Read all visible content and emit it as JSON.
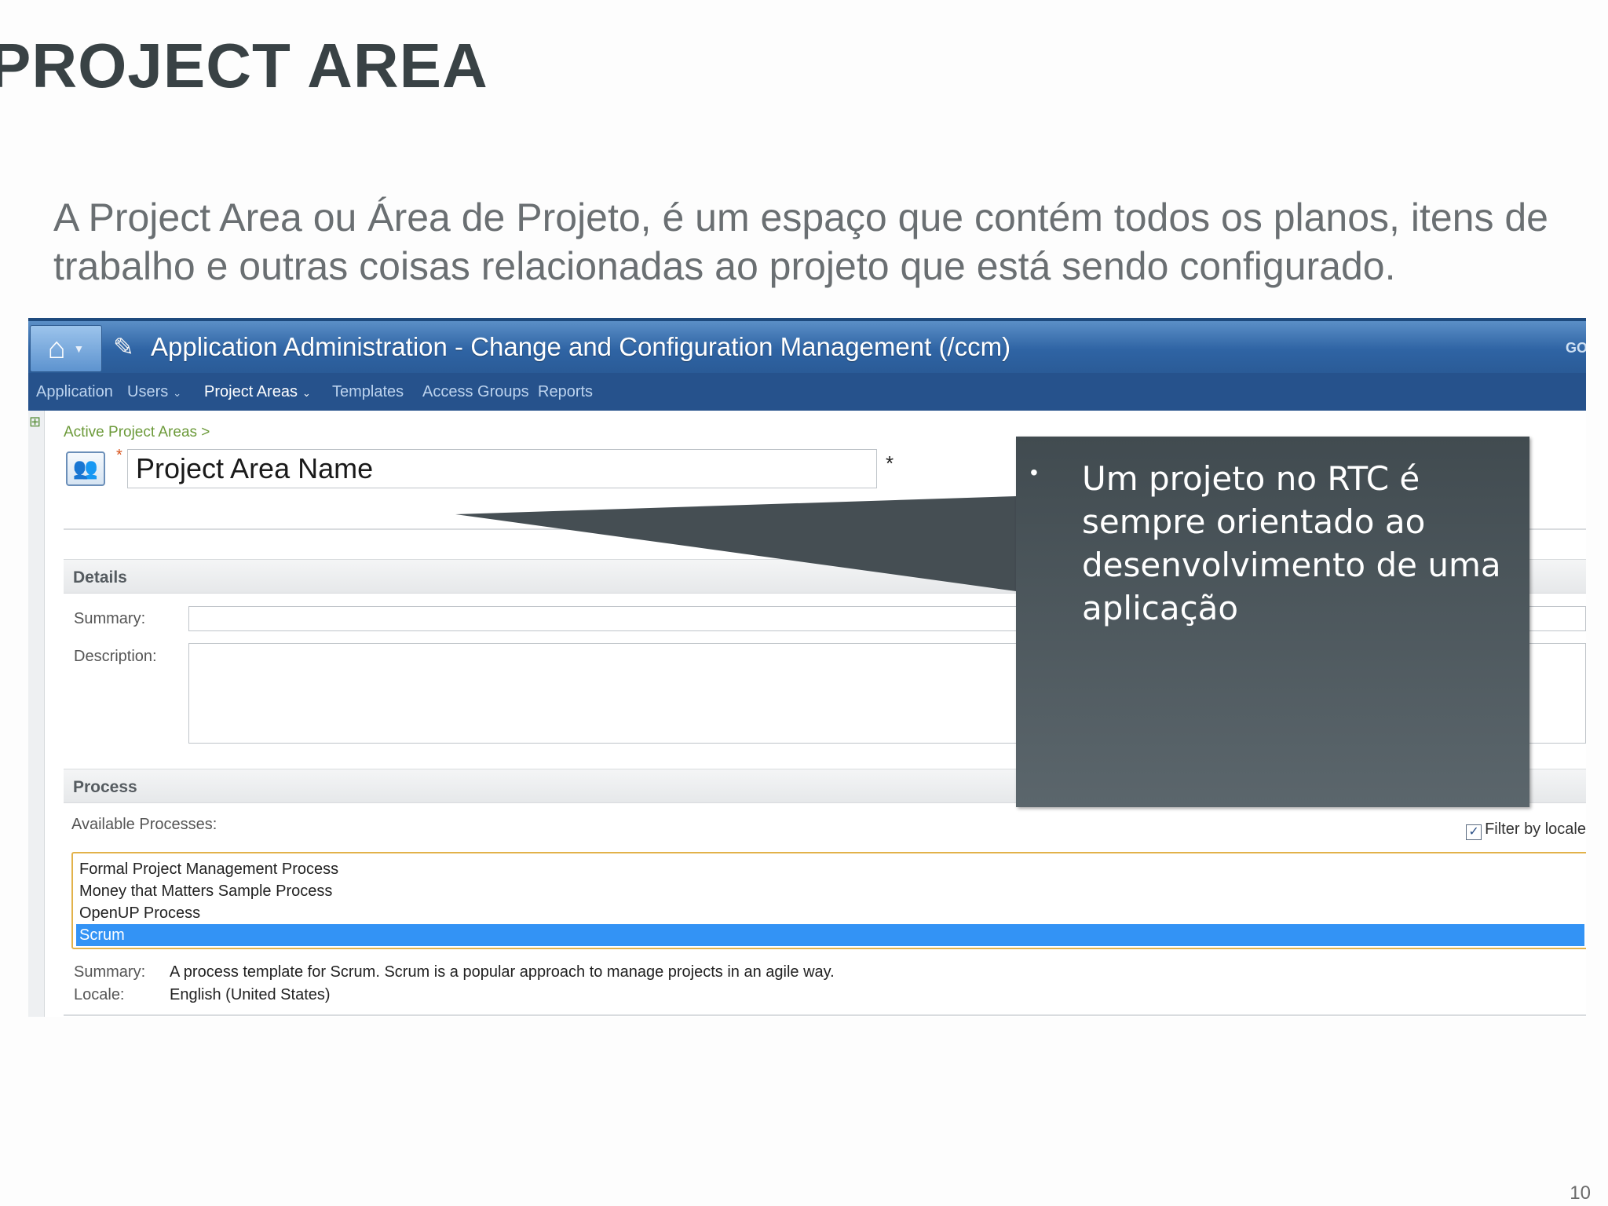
{
  "slide": {
    "title": "PROJECT AREA",
    "intro": "A Project Area ou Área de Projeto, é um espaço que contém todos os planos, itens de trabalho e outras coisas relacionadas ao projeto que está sendo configurado.",
    "page_number": "10"
  },
  "app": {
    "title": "Application Administration - Change and Configuration Management (/ccm)",
    "go_text": "GO",
    "menu": [
      {
        "label": "Application",
        "active": false
      },
      {
        "label": "Users",
        "active": false
      },
      {
        "label": "Project Areas",
        "active": true
      },
      {
        "label": "Templates",
        "active": false
      },
      {
        "label": "Access Groups",
        "active": false
      },
      {
        "label": "Reports",
        "active": false
      }
    ],
    "breadcrumb": "Active Project Areas >",
    "required_marker": "*",
    "name_field": {
      "value": "Project Area Name",
      "marker": "*"
    },
    "details": {
      "heading": "Details",
      "summary_label": "Summary:",
      "description_label": "Description:"
    },
    "process": {
      "heading": "Process",
      "available_label": "Available Processes:",
      "filter_label": "Filter by locale",
      "filter_checked": true,
      "options": [
        "Formal Project Management Process",
        "Money that Matters Sample Process",
        "OpenUP Process",
        "Scrum"
      ],
      "selected": "Scrum",
      "summary_label": "Summary:",
      "summary_value": "A process template for Scrum. Scrum is a popular approach to manage projects in an agile way.",
      "locale_label": "Locale:",
      "locale_value": "English (United States)"
    }
  },
  "callout": {
    "bullet": "•",
    "text": "Um projeto no RTC é sempre orientado ao desenvolvimento de uma aplicação"
  },
  "colors": {
    "title_text": "#394245",
    "titlebar": "#2f64a4",
    "menubar": "#26528c",
    "selection": "#3393f5",
    "callout": "#4e595f",
    "list_border": "#e2b24a"
  },
  "icons": {
    "home": "home-icon",
    "admin": "admin-tools-icon",
    "project_area": "people-icon",
    "filter": "checkbox-checked-icon"
  }
}
